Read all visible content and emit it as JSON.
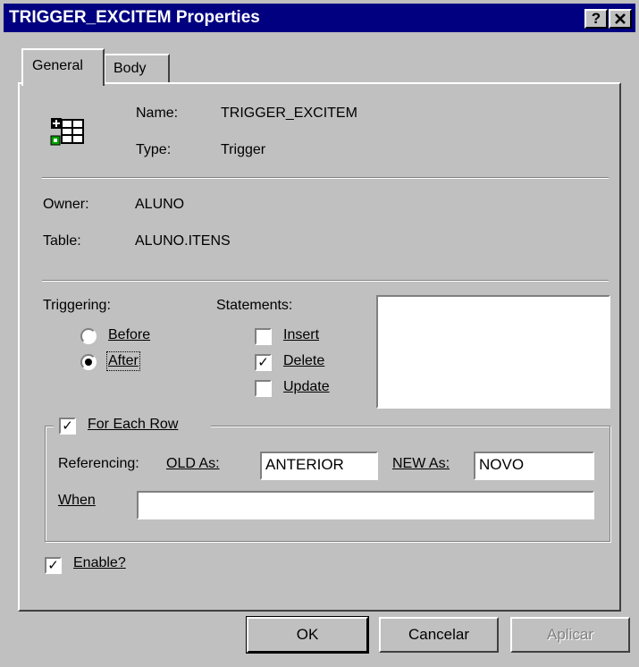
{
  "window": {
    "title": "TRIGGER_EXCITEM Properties",
    "help_button": "?",
    "close_button": "✕"
  },
  "tabs": [
    {
      "label": "General",
      "active": true
    },
    {
      "label": "Body",
      "active": false
    }
  ],
  "object": {
    "icon": "trigger-object-icon",
    "name_label": "Name:",
    "name_value": "TRIGGER_EXCITEM",
    "type_label": "Type:",
    "type_value": "Trigger"
  },
  "owner": {
    "owner_label": "Owner:",
    "owner_value": "ALUNO",
    "table_label": "Table:",
    "table_value": "ALUNO.ITENS"
  },
  "triggering": {
    "label": "Triggering:",
    "options": [
      {
        "label": "Before",
        "selected": false
      },
      {
        "label": "After",
        "selected": true
      }
    ]
  },
  "statements": {
    "label": "Statements:",
    "options": [
      {
        "label": "Insert",
        "checked": false
      },
      {
        "label": "Delete",
        "checked": true
      },
      {
        "label": "Update",
        "checked": false
      }
    ]
  },
  "for_each_row": {
    "label": "For Each Row",
    "checked": true,
    "referencing_label": "Referencing:",
    "old_label": "OLD As:",
    "old_value": "ANTERIOR",
    "new_label": "NEW As:",
    "new_value": "NOVO",
    "when_label": "When",
    "when_value": ""
  },
  "enable": {
    "label": "Enable?",
    "checked": true
  },
  "buttons": {
    "ok": "OK",
    "cancel": "Cancelar",
    "apply": "Aplicar",
    "apply_enabled": false
  },
  "colors": {
    "titlebar": "#000080",
    "face": "#c0c0c0"
  }
}
